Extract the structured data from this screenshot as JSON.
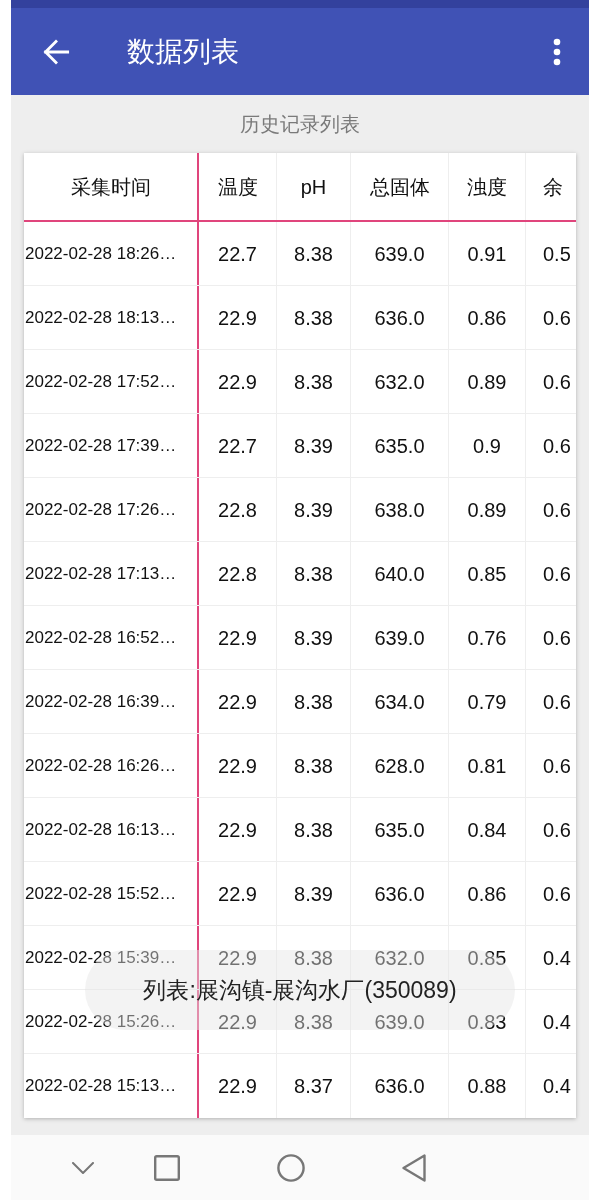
{
  "app_bar": {
    "title": "数据列表"
  },
  "subtitle": "历史记录列表",
  "table": {
    "columns": [
      "采集时间",
      "温度",
      "pH",
      "总固体",
      "浊度",
      "余"
    ],
    "rows": [
      [
        "2022-02-28 18:26…",
        "22.7",
        "8.38",
        "639.0",
        "0.91",
        "0.5"
      ],
      [
        "2022-02-28 18:13…",
        "22.9",
        "8.38",
        "636.0",
        "0.86",
        "0.6"
      ],
      [
        "2022-02-28 17:52…",
        "22.9",
        "8.38",
        "632.0",
        "0.89",
        "0.6"
      ],
      [
        "2022-02-28 17:39…",
        "22.7",
        "8.39",
        "635.0",
        "0.9",
        "0.6"
      ],
      [
        "2022-02-28 17:26…",
        "22.8",
        "8.39",
        "638.0",
        "0.89",
        "0.6"
      ],
      [
        "2022-02-28 17:13…",
        "22.8",
        "8.38",
        "640.0",
        "0.85",
        "0.6"
      ],
      [
        "2022-02-28 16:52…",
        "22.9",
        "8.39",
        "639.0",
        "0.76",
        "0.6"
      ],
      [
        "2022-02-28 16:39…",
        "22.9",
        "8.38",
        "634.0",
        "0.79",
        "0.6"
      ],
      [
        "2022-02-28 16:26…",
        "22.9",
        "8.38",
        "628.0",
        "0.81",
        "0.6"
      ],
      [
        "2022-02-28 16:13…",
        "22.9",
        "8.38",
        "635.0",
        "0.84",
        "0.6"
      ],
      [
        "2022-02-28 15:52…",
        "22.9",
        "8.39",
        "636.0",
        "0.86",
        "0.6"
      ],
      [
        "2022-02-28 15:39…",
        "22.9",
        "8.38",
        "632.0",
        "0.85",
        "0.4"
      ],
      [
        "2022-02-28 15:26…",
        "22.9",
        "8.38",
        "639.0",
        "0.83",
        "0.4"
      ],
      [
        "2022-02-28 15:13…",
        "22.9",
        "8.37",
        "636.0",
        "0.88",
        "0.4"
      ]
    ]
  },
  "toast": "列表:展沟镇-展沟水厂(350089)"
}
